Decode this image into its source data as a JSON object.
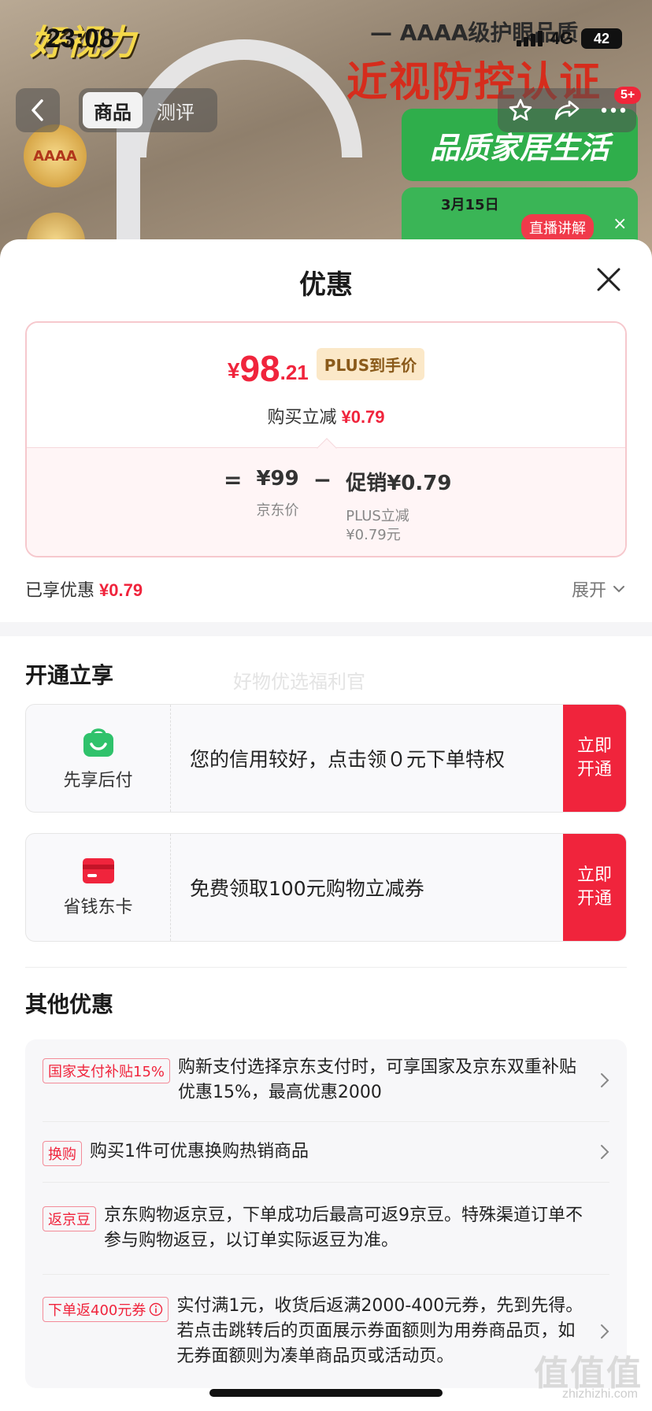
{
  "status_bar": {
    "time": "23:08",
    "network": "4G",
    "battery": "42"
  },
  "hero": {
    "brand": "好视力",
    "tag_line": "— AAAA级护眼品质",
    "headline": "近视防控认证",
    "green_badge": "品质家居生活",
    "date_badge": "3月15日",
    "medal_text": "AAAA"
  },
  "nav": {
    "tabs": [
      {
        "label": "商品",
        "active": true
      },
      {
        "label": "测评",
        "active": false
      }
    ],
    "cart_badge": "5+",
    "live_label": "直播讲解"
  },
  "sheet": {
    "title": "优惠",
    "price": {
      "symbol": "¥",
      "integer": "98",
      "decimal": ".21",
      "plus_tag": "PLUS到手价",
      "reduce_label": "购买立减",
      "reduce_value": "¥0.79",
      "eq": "=",
      "base_value": "¥99",
      "base_label": "京东价",
      "minus": "−",
      "promo_value": "促销¥0.79",
      "promo_sub1": "PLUS立减",
      "promo_sub2": "¥0.79元"
    },
    "enjoyed_label": "已享优惠",
    "enjoyed_value": "¥0.79",
    "expand_label": "展开"
  },
  "open_section": {
    "title": "开通立享",
    "watermark": "好物优选福利官",
    "cards": [
      {
        "label": "先享后付",
        "desc": "您的信用较好，点击领０元下单特权",
        "button_line1": "立即",
        "button_line2": "开通",
        "icon": "shopping-bag-icon",
        "icon_color": "#2fc26b"
      },
      {
        "label": "省钱东卡",
        "desc": "免费领取100元购物立减券",
        "button_line1": "立即",
        "button_line2": "开通",
        "icon": "card-icon",
        "icon_color": "#f0243c"
      }
    ]
  },
  "other_section": {
    "title": "其他优惠",
    "items": [
      {
        "tag": "国家支付补贴15%",
        "text": "购新支付选择京东支付时，可享国家及京东双重补贴优惠15%，最高优惠2000",
        "chevron": true
      },
      {
        "tag": "换购",
        "text": "购买1件可优惠换购热销商品",
        "chevron": true
      },
      {
        "tag": "返京豆",
        "text": "京东购物返京豆，下单成功后最高可返9京豆。特殊渠道订单不参与购物返豆，以订单实际返豆为准。",
        "chevron": false
      },
      {
        "tag": "下单返400元券",
        "text": "实付满1元，收货后返满2000-400元券，先到先得。若点击跳转后的页面展示券面额则为用券商品页，如无券面额则为凑单商品页或活动页。",
        "chevron": true,
        "info_icon": true
      }
    ]
  },
  "watermark_corner": {
    "logo": "值值值",
    "site": "zhizhizhi.com"
  },
  "colors": {
    "accent": "#f0243c",
    "plus_bg": "#fbe8c8",
    "green": "#2fc26b"
  }
}
